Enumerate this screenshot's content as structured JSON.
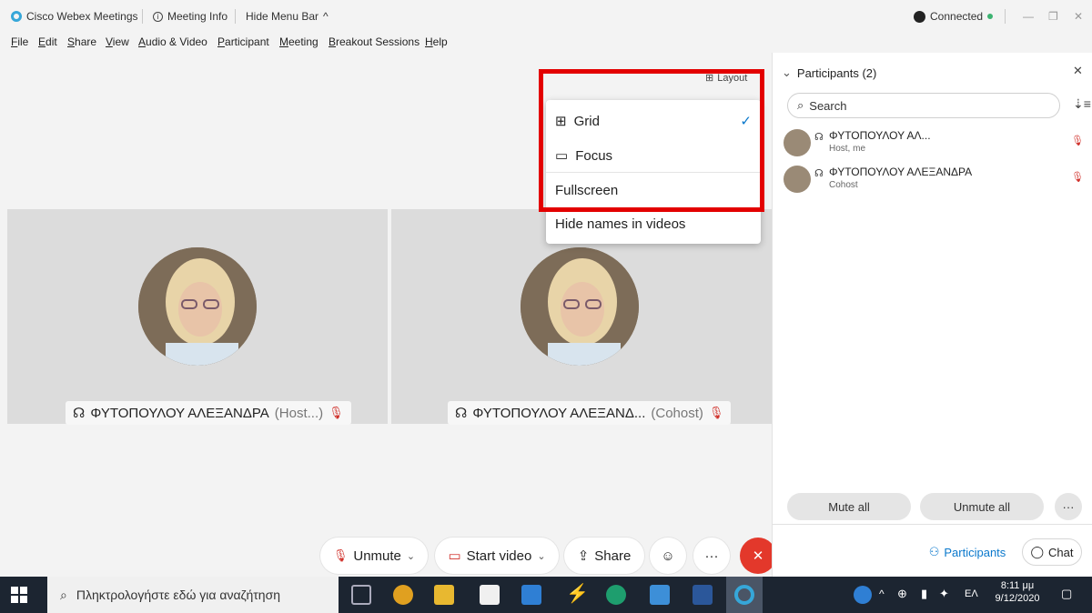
{
  "titlebar": {
    "app_name": "Cisco Webex Meetings",
    "meeting_info": "Meeting Info",
    "hide_menu_bar": "Hide Menu Bar",
    "status": "Connected"
  },
  "menu": [
    "File",
    "Edit",
    "Share",
    "View",
    "Audio & Video",
    "Participant",
    "Meeting",
    "Breakout Sessions",
    "Help"
  ],
  "stage": {
    "layout_label": "Layout",
    "tiles": [
      {
        "name": "ΦΥΤΟΠΟΥΛΟΥ ΑΛΕΞΑΝΔΡΑ",
        "role": "(Host...)"
      },
      {
        "name": "ΦΥΤΟΠΟΥΛΟΥ ΑΛΕΞΑΝΔ...",
        "role": "(Cohost)"
      }
    ]
  },
  "layout_menu": {
    "items": [
      {
        "label": "Grid",
        "checked": true
      },
      {
        "label": "Focus",
        "checked": false
      },
      {
        "label": "Fullscreen",
        "checked": false
      },
      {
        "label": "Hide names in videos",
        "checked": false
      }
    ]
  },
  "controls": {
    "unmute": "Unmute",
    "start_video": "Start video",
    "share": "Share",
    "more": "···"
  },
  "panel": {
    "title": "Participants (2)",
    "search_placeholder": "Search",
    "participants": [
      {
        "name": "ΦΥΤΟΠΟΥΛΟΥ ΑΛ...",
        "role": "Host, me"
      },
      {
        "name": "ΦΥΤΟΠΟΥΛΟΥ ΑΛΕΞΑΝΔΡΑ",
        "role": "Cohost"
      }
    ],
    "mute_all": "Mute all",
    "unmute_all": "Unmute all",
    "participants_tab": "Participants",
    "chat_tab": "Chat"
  },
  "taskbar": {
    "search_placeholder": "Πληκτρολογήστε εδώ για αναζήτηση",
    "lang": "ΕΛ",
    "time": "8:11 μμ",
    "date": "9/12/2020"
  },
  "colors": {
    "accent": "#0a78cc",
    "end_call": "#e3382b",
    "highlight": "#e30000"
  }
}
